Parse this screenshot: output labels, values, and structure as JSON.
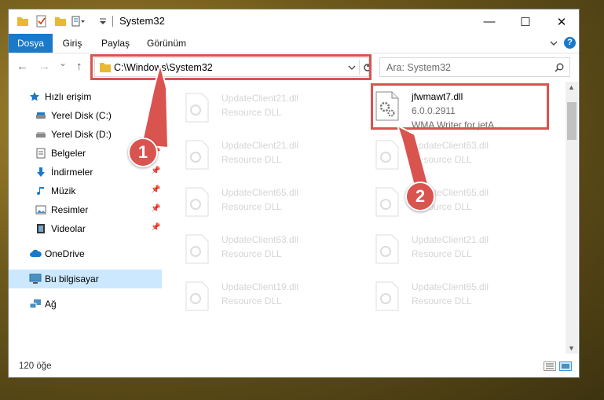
{
  "window": {
    "title": "System32",
    "controls": {
      "minimize": "—",
      "maximize": "☐",
      "close": "✕"
    }
  },
  "ribbon": {
    "tabs": [
      {
        "label": "Dosya",
        "active": true
      },
      {
        "label": "Giriş"
      },
      {
        "label": "Paylaş"
      },
      {
        "label": "Görünüm"
      }
    ],
    "expand_icon": "chevron-down-icon",
    "help_icon": "?"
  },
  "navbar": {
    "back": "←",
    "forward": "→",
    "recent": "⌄",
    "up": "↑",
    "address": "C:\\Windows\\System32",
    "search_placeholder": "Ara: System32"
  },
  "sidebar": {
    "items": [
      {
        "label": "Hızlı erişim",
        "icon": "star-icon"
      },
      {
        "label": "Yerel Disk (C:)",
        "icon": "drive-icon",
        "pinned": true
      },
      {
        "label": "Yerel Disk (D:)",
        "icon": "drive-icon",
        "pinned": true
      },
      {
        "label": "Belgeler",
        "icon": "documents-icon",
        "pinned": true
      },
      {
        "label": "İndirmeler",
        "icon": "download-icon",
        "pinned": true
      },
      {
        "label": "Müzik",
        "icon": "music-icon",
        "pinned": true
      },
      {
        "label": "Resimler",
        "icon": "pictures-icon",
        "pinned": true
      },
      {
        "label": "Videolar",
        "icon": "video-icon",
        "pinned": true
      },
      {
        "label": "OneDrive",
        "icon": "cloud-icon"
      },
      {
        "label": "Bu bilgisayar",
        "icon": "computer-icon",
        "selected": true
      },
      {
        "label": "Ağ",
        "icon": "network-icon"
      }
    ]
  },
  "files": {
    "left": [
      {
        "name": "UpdateClient21.dll",
        "type": "Resource DLL"
      },
      {
        "name": "UpdateClient21.dll",
        "type": "Resource DLL"
      },
      {
        "name": "UpdateClient65.dll",
        "type": "Resource DLL"
      },
      {
        "name": "UpdateClient63.dll",
        "type": "Resource DLL"
      },
      {
        "name": "UpdateClient19.dll",
        "type": "Resource DLL"
      }
    ],
    "right": [
      {
        "name": "jfwmawt7.dll",
        "version": "6.0.0.2911",
        "description": "WMA Writer for jetA...",
        "highlighted": true
      },
      {
        "name": "UpdateClient63.dll",
        "type": "Resource DLL"
      },
      {
        "name": "UpdateClient65.dll",
        "type": "Resource DLL"
      },
      {
        "name": "UpdateClient21.dll",
        "type": "Resource DLL"
      },
      {
        "name": "UpdateClient65.dll",
        "type": "Resource DLL"
      }
    ]
  },
  "status": {
    "item_count": "120 öğe"
  },
  "callouts": {
    "first": "1",
    "second": "2"
  },
  "colors": {
    "accent": "#1979ca",
    "highlight": "#d9534f",
    "selected": "#cce8ff"
  }
}
